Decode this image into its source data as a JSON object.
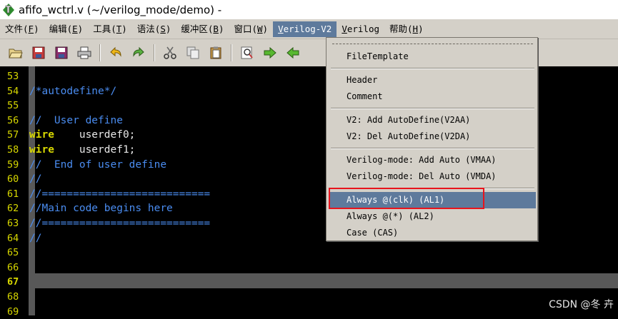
{
  "window": {
    "title": "afifo_wctrl.v (~/verilog_mode/demo) -",
    "app_icon": "gvim-icon"
  },
  "menubar": {
    "items": [
      {
        "label": "文件(",
        "key": "F",
        "end": ")"
      },
      {
        "label": "编辑(",
        "key": "E",
        "end": ")"
      },
      {
        "label": "工具(",
        "key": "T",
        "end": ")"
      },
      {
        "label": "语法(",
        "key": "S",
        "end": ")"
      },
      {
        "label": "缓冲区(",
        "key": "B",
        "end": ")"
      },
      {
        "label": "窗口(",
        "key": "W",
        "end": ")"
      },
      {
        "label": "",
        "key": "V",
        "end": "erilog-V2",
        "active": true
      },
      {
        "label": "",
        "key": "V",
        "end": "erilog"
      },
      {
        "label": "帮助(",
        "key": "H",
        "end": ")"
      }
    ]
  },
  "toolbar": {
    "icons": [
      "open-folder-icon",
      "save-icon",
      "save-all-icon",
      "print-icon",
      "undo-icon",
      "redo-icon",
      "cut-icon",
      "copy-icon",
      "paste-icon",
      "find-replace-icon",
      "forward-icon",
      "back-icon"
    ]
  },
  "editor": {
    "lines": [
      {
        "n": "53",
        "text": "",
        "type": "plain"
      },
      {
        "n": "54",
        "text": "/*autodefine*/",
        "type": "comment"
      },
      {
        "n": "55",
        "text": "",
        "type": "plain"
      },
      {
        "n": "56",
        "text": "//  User define",
        "type": "comment"
      },
      {
        "n": "57",
        "kw": "wire",
        "rest": "    userdef0;",
        "type": "kw"
      },
      {
        "n": "58",
        "kw": "wire",
        "rest": "    userdef1;",
        "type": "kw"
      },
      {
        "n": "59",
        "text": "//  End of user define",
        "type": "comment"
      },
      {
        "n": "60",
        "text": "//",
        "type": "comment"
      },
      {
        "n": "61",
        "text": "//===========================",
        "type": "comment"
      },
      {
        "n": "62",
        "text": "//Main code begins here",
        "type": "comment"
      },
      {
        "n": "63",
        "text": "//===========================",
        "type": "comment"
      },
      {
        "n": "64",
        "text": "//",
        "type": "comment"
      },
      {
        "n": "65",
        "text": "",
        "type": "plain"
      },
      {
        "n": "66",
        "text": "",
        "type": "plain"
      },
      {
        "n": "67",
        "text": "",
        "type": "plain",
        "current": true
      },
      {
        "n": "68",
        "text": "",
        "type": "plain"
      },
      {
        "n": "69",
        "text": "",
        "type": "plain"
      }
    ]
  },
  "dropdown": {
    "menu": "Verilog-V2",
    "items": [
      {
        "label": "FileTemplate"
      },
      {
        "sep": true
      },
      {
        "label": "Header"
      },
      {
        "label": "Comment"
      },
      {
        "sep": true
      },
      {
        "label": "V2: Add AutoDefine(V2AA)"
      },
      {
        "label": "V2: Del AutoDefine(V2DA)"
      },
      {
        "sep": true
      },
      {
        "label": "Verilog-mode: Add Auto (VMAA)"
      },
      {
        "label": "Verilog-mode: Del Auto (VMDA)"
      },
      {
        "sep": true
      },
      {
        "label": "Always @(clk) (AL1)",
        "highlighted": true
      },
      {
        "label": "Always @(*) (AL2)"
      },
      {
        "label": "Case (CAS)"
      }
    ]
  },
  "watermark": "CSDN @冬 卉",
  "colors": {
    "menu_bg": "#d4d0c8",
    "highlight": "#5e7a9c",
    "line_number": "#d8d800",
    "comment": "#4a8cf0",
    "annotation_box": "#e8141c"
  }
}
